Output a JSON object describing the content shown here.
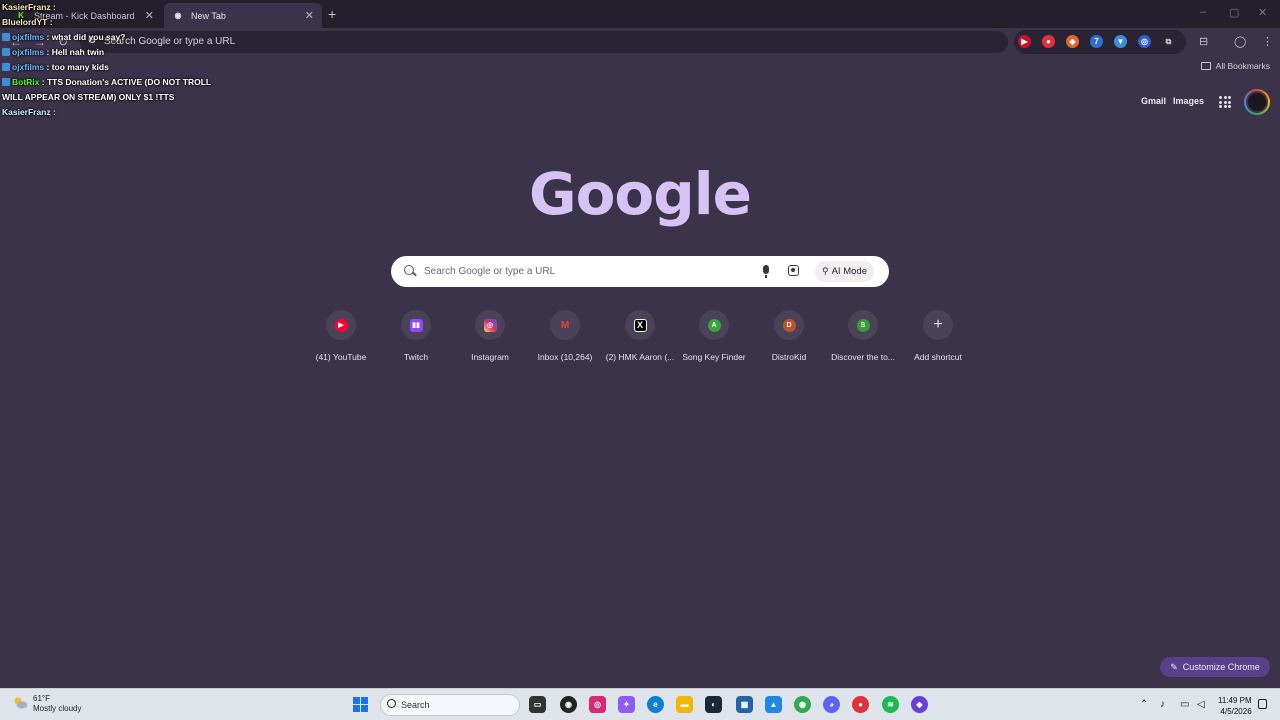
{
  "browser": {
    "tabs": [
      {
        "title": "Stream - Kick Dashboard",
        "favicon": "kick-icon",
        "active": false
      },
      {
        "title": "New Tab",
        "favicon": "chrome-icon",
        "active": true
      }
    ],
    "new_tab_symbol": "+",
    "omnibox_text": "Search Google or type a URL",
    "all_bookmarks": "All Bookmarks",
    "window_controls": [
      "–",
      "▢",
      "✕"
    ]
  },
  "chat_overlay": [
    {
      "user": "KasierFranz",
      "message": ""
    },
    {
      "user": "BluelordYT",
      "message": ""
    },
    {
      "user": "ojxfilms",
      "message": "what did you say?"
    },
    {
      "user": "ojxfilms",
      "message": "Hell nah twin"
    },
    {
      "user": "ojxfilms",
      "message": "too many kids"
    },
    {
      "user": "BotRix",
      "message": "TTS Donation's ACTIVE (DO NOT TROLL"
    },
    {
      "user": "",
      "message": "WILL APPEAR ON STREAM) ONLY $1 !TTS"
    },
    {
      "user": "KasierFranz",
      "message": ""
    }
  ],
  "header": {
    "gmail": "Gmail",
    "images": "Images",
    "apps_icon": "apps-grid-icon",
    "avatar": "profile-avatar"
  },
  "logo": "Google",
  "search": {
    "placeholder": "Search Google or type a URL",
    "ai_mode": "AI Mode"
  },
  "shortcuts": [
    {
      "label": "(41) YouTube",
      "icon": "youtube-icon",
      "color": "#ff0033",
      "glyph": "▶"
    },
    {
      "label": "Twitch",
      "icon": "twitch-icon",
      "color": "#9146ff",
      "glyph": "▮▮"
    },
    {
      "label": "Instagram",
      "icon": "instagram-icon",
      "color": "#d62976",
      "glyph": "◎"
    },
    {
      "label": "Inbox (10,264)",
      "icon": "gmail-icon",
      "color": "#ea4335",
      "glyph": "M"
    },
    {
      "label": "(2) HMK Aaron (...",
      "icon": "x-icon",
      "color": "#000000",
      "glyph": "X"
    },
    {
      "label": "Song Key Finder",
      "icon": "letter-a-icon",
      "color": "#3aa33a",
      "glyph": "A"
    },
    {
      "label": "DistroKid",
      "icon": "letter-d-icon",
      "color": "#b8552f",
      "glyph": "D"
    },
    {
      "label": "Discover the to...",
      "icon": "letter-s-icon",
      "color": "#3a9a3a",
      "glyph": "S"
    },
    {
      "label": "Add shortcut",
      "icon": "plus-icon",
      "color": "",
      "glyph": "+"
    }
  ],
  "customize": "Customize Chrome",
  "taskbar": {
    "weather_temp": "61°F",
    "weather_desc": "Mostly cloudy",
    "search_label": "Search",
    "time": "11:49 PM",
    "date": "4/5/2026"
  }
}
